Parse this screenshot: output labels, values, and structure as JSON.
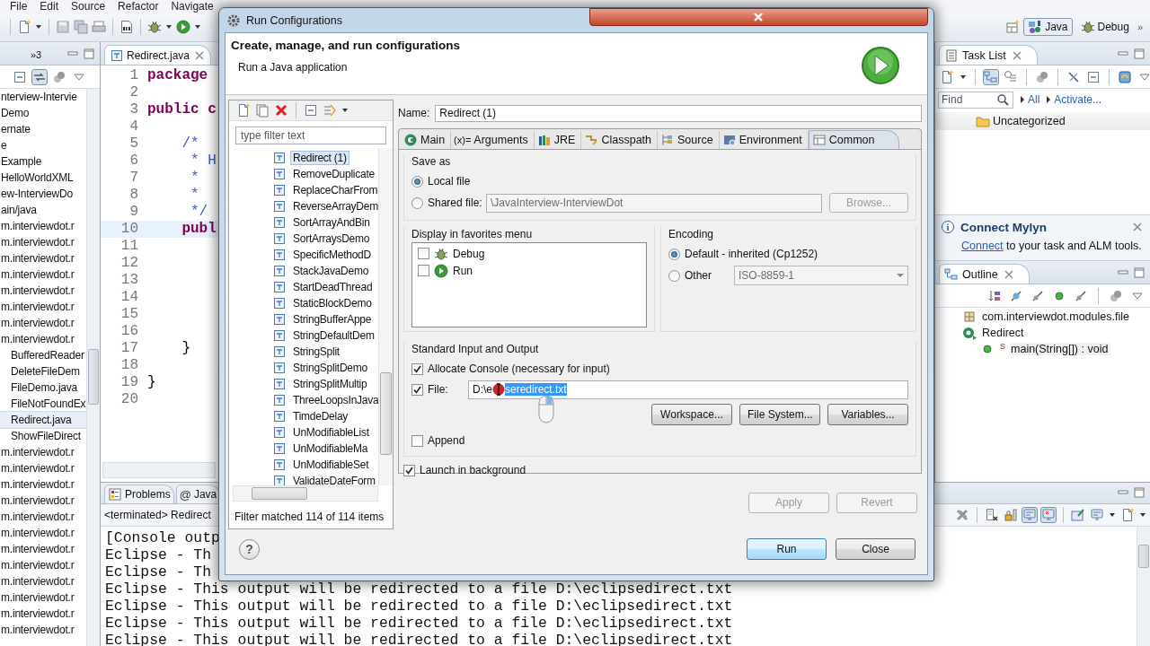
{
  "menu_bar": [
    "File",
    "Edit",
    "Source",
    "Refactor",
    "Navigate"
  ],
  "perspectives": {
    "items": [
      {
        "label": "Java",
        "selected": true
      },
      {
        "label": "Debug",
        "selected": false
      }
    ],
    "overflow": "»"
  },
  "explorer": {
    "tab_overflow": "»3",
    "items": [
      {
        "label": "nterview-Intervie",
        "selected": false
      },
      {
        "label": "Demo",
        "selected": false
      },
      {
        "label": "ernate",
        "selected": false
      },
      {
        "label": "e",
        "selected": false
      },
      {
        "label": "Example",
        "selected": false
      },
      {
        "label": "HelloWorldXML",
        "selected": false
      },
      {
        "label": "ew-InterviewDo",
        "selected": false
      },
      {
        "label": "ain/java",
        "selected": false
      },
      {
        "label": "m.interviewdot.r",
        "selected": false
      },
      {
        "label": "m.interviewdot.r",
        "selected": false
      },
      {
        "label": "m.interviewdot.r",
        "selected": false
      },
      {
        "label": "m.interviewdot.r",
        "selected": false
      },
      {
        "label": "m.interviewdot.r",
        "selected": false
      },
      {
        "label": "m.interviewdot.r",
        "selected": false
      },
      {
        "label": "m.interviewdot.r",
        "selected": false
      },
      {
        "label": "m.interviewdot.r",
        "selected": false,
        "children": [
          {
            "label": "BufferedReader",
            "selected": false
          },
          {
            "label": "DeleteFileDem",
            "selected": false
          },
          {
            "label": "FileDemo.java",
            "selected": false
          },
          {
            "label": "FileNotFoundEx",
            "selected": false
          },
          {
            "label": "Redirect.java",
            "selected": true
          },
          {
            "label": "ShowFileDirect",
            "selected": false
          }
        ]
      },
      {
        "label": "m.interviewdot.r",
        "selected": false
      },
      {
        "label": "m.interviewdot.r",
        "selected": false
      },
      {
        "label": "m.interviewdot.r",
        "selected": false
      },
      {
        "label": "m.interviewdot.r",
        "selected": false
      },
      {
        "label": "m.interviewdot.r",
        "selected": false
      },
      {
        "label": "m.interviewdot.r",
        "selected": false
      },
      {
        "label": "m.interviewdot.r",
        "selected": false
      },
      {
        "label": "m.interviewdot.r",
        "selected": false
      },
      {
        "label": "m.interviewdot.r",
        "selected": false
      },
      {
        "label": "m.interviewdot.r",
        "selected": false
      },
      {
        "label": "m.interviewdot.r",
        "selected": false
      },
      {
        "label": "m.interviewdot.r",
        "selected": false
      }
    ]
  },
  "editor": {
    "tab": "Redirect.java",
    "lines": [
      {
        "number": "1",
        "code": "package",
        "kind": "keyword",
        "current": false
      },
      {
        "number": "2",
        "kind": "plain",
        "current": false
      },
      {
        "number": "3",
        "code": "public c",
        "kind": "keyword",
        "current": false
      },
      {
        "number": "4",
        "kind": "plain",
        "current": false
      },
      {
        "number": "5",
        "code": "    /*",
        "kind": "comment",
        "current": false
      },
      {
        "number": "6",
        "code": "     * H",
        "kind": "comment",
        "current": false
      },
      {
        "number": "7",
        "code": "     *",
        "kind": "comment",
        "current": false
      },
      {
        "number": "8",
        "code": "     *",
        "kind": "comment",
        "current": false
      },
      {
        "number": "9",
        "code": "     */",
        "kind": "comment",
        "current": false
      },
      {
        "number": "10",
        "code": "    publ",
        "kind": "keyword",
        "current": true
      },
      {
        "number": "11",
        "kind": "plain",
        "current": false
      },
      {
        "number": "12",
        "kind": "plain",
        "current": false
      },
      {
        "number": "13",
        "kind": "plain",
        "current": false
      },
      {
        "number": "14",
        "kind": "plain",
        "current": false
      },
      {
        "number": "15",
        "kind": "plain",
        "current": false
      },
      {
        "number": "16",
        "kind": "plain",
        "current": false
      },
      {
        "number": "17",
        "code": "    }",
        "kind": "plain",
        "current": false
      },
      {
        "number": "18",
        "kind": "plain",
        "current": false
      },
      {
        "number": "19",
        "code": "}",
        "kind": "plain",
        "current": false
      },
      {
        "number": "20",
        "kind": "plain",
        "current": false
      }
    ]
  },
  "console": {
    "tabs": [
      {
        "label": "Problems",
        "kind": "problems"
      },
      {
        "label": "Java",
        "kind": "javadoc",
        "icon_text": "@"
      }
    ],
    "header": "<terminated> Redirect",
    "lines": [
      "[Console outp",
      "Eclipse - Th",
      "Eclipse - Th",
      "Eclipse - This output will be redirected to a file D:\\eclipsedirect.txt",
      "Eclipse - This output will be redirected to a file D:\\eclipsedirect.txt",
      "Eclipse - This output will be redirected to a file D:\\eclipsedirect.txt",
      "Eclipse - This output will be redirected to a file D:\\eclipsedirect.txt"
    ]
  },
  "task_list": {
    "title": "Task List",
    "find_placeholder": "Find",
    "links": [
      "All",
      "Activate..."
    ],
    "items": [
      "Uncategorized"
    ]
  },
  "mylyn": {
    "title": "Connect Mylyn",
    "link": "Connect",
    "text": "to your task and ALM tools."
  },
  "outline": {
    "title": "Outline",
    "items": [
      {
        "label": "com.interviewdot.modules.file",
        "kind": "package"
      },
      {
        "label": "Redirect",
        "kind": "class",
        "children": [
          {
            "label": "main(String[]) : void",
            "kind": "method",
            "modifier": "S"
          }
        ]
      }
    ]
  },
  "dialog": {
    "title": "Run Configurations",
    "heading": "Create, manage, and run configurations",
    "subheading": "Run a Java application",
    "filter_placeholder": "type filter text",
    "configs": [
      {
        "label": "Redirect (1)",
        "selected": true
      },
      {
        "label": "RemoveDuplicate",
        "selected": false
      },
      {
        "label": "ReplaceCharFrom",
        "selected": false
      },
      {
        "label": "ReverseArrayDem",
        "selected": false
      },
      {
        "label": "SortArrayAndBin",
        "selected": false
      },
      {
        "label": "SortArraysDemo",
        "selected": false
      },
      {
        "label": "SpecificMethodD",
        "selected": false
      },
      {
        "label": "StackJavaDemo",
        "selected": false
      },
      {
        "label": "StartDeadThread",
        "selected": false
      },
      {
        "label": "StaticBlockDemo",
        "selected": false
      },
      {
        "label": "StringBufferAppe",
        "selected": false
      },
      {
        "label": "StringDefaultDem",
        "selected": false
      },
      {
        "label": "StringSplit",
        "selected": false
      },
      {
        "label": "StringSplitDemo",
        "selected": false
      },
      {
        "label": "StringSplitMultip",
        "selected": false
      },
      {
        "label": "ThreeLoopsInJava",
        "selected": false
      },
      {
        "label": "TimdeDelay",
        "selected": false
      },
      {
        "label": "UnModifiableList",
        "selected": false
      },
      {
        "label": "UnModifiableMa",
        "selected": false
      },
      {
        "label": "UnModifiableSet",
        "selected": false
      },
      {
        "label": "ValidateDateForm",
        "selected": false
      }
    ],
    "filter_status": "Filter matched 114 of 114 items",
    "name_label": "Name:",
    "name_value": "Redirect (1)",
    "tabs": [
      {
        "label": "Main",
        "kind": "main",
        "selected": false
      },
      {
        "label": "Arguments",
        "kind": "arguments",
        "icon_text": "(x)=",
        "selected": false
      },
      {
        "label": "JRE",
        "kind": "jre",
        "selected": false
      },
      {
        "label": "Classpath",
        "kind": "classpath",
        "selected": false
      },
      {
        "label": "Source",
        "kind": "source",
        "selected": false
      },
      {
        "label": "Environment",
        "kind": "environment",
        "selected": false
      },
      {
        "label": "Common",
        "kind": "common",
        "selected": true
      }
    ],
    "save_as": {
      "title": "Save as",
      "options": [
        {
          "label": "Local file",
          "selected": true
        },
        {
          "label": "Shared file:",
          "selected": false
        }
      ],
      "shared_path": "\\JavaInterview-InterviewDot",
      "browse": "Browse..."
    },
    "favorites": {
      "title": "Display in favorites menu",
      "items": [
        {
          "label": "Debug",
          "kind": "debug",
          "checked": false
        },
        {
          "label": "Run",
          "kind": "run",
          "checked": false
        }
      ]
    },
    "encoding": {
      "title": "Encoding",
      "options": [
        {
          "label": "Default - inherited (Cp1252)",
          "selected": true
        },
        {
          "label": "Other",
          "selected": false
        }
      ],
      "other_value": "ISO-8859-1"
    },
    "std_io": {
      "title": "Standard Input and Output",
      "allocate_console": {
        "label": "Allocate Console (necessary for input)",
        "checked": true
      },
      "file": {
        "label": "File:",
        "checked": true,
        "value_start": "D:\\e",
        "value_selected": "seredirect.txt"
      },
      "buttons": [
        "Workspace...",
        "File System...",
        "Variables..."
      ],
      "append": {
        "label": "Append",
        "checked": false
      }
    },
    "launch_background": {
      "label": "Launch in background",
      "checked": true
    },
    "apply_buttons": [
      {
        "label": "Apply",
        "disabled": true
      },
      {
        "label": "Revert",
        "disabled": true
      }
    ],
    "help": "?",
    "buttons": [
      {
        "label": "Run",
        "default": true
      },
      {
        "label": "Close",
        "default": false
      }
    ]
  }
}
